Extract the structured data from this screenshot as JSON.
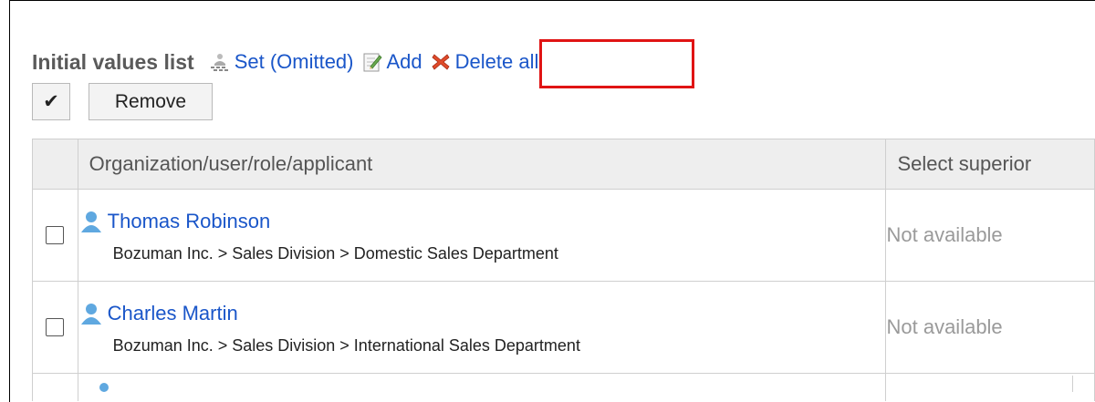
{
  "header": {
    "title": "Initial values list",
    "set_label": "Set (Omitted)",
    "add_label": "Add",
    "delete_all_label": "Delete all"
  },
  "toolbar": {
    "check_label": "✔",
    "remove_label": "Remove"
  },
  "table": {
    "columns": [
      "Organization/user/role/applicant",
      "Select superior"
    ],
    "rows": [
      {
        "name": "Thomas Robinson",
        "path": "Bozuman Inc. > Sales Division > Domestic Sales Department",
        "superior": "Not available"
      },
      {
        "name": "Charles Martin",
        "path": "Bozuman Inc. > Sales Division > International Sales Department",
        "superior": "Not available"
      }
    ]
  },
  "icons": {
    "set": "users-group-icon",
    "add": "edit-note-icon",
    "delete_all": "red-x-icon",
    "user": "user-icon"
  },
  "colors": {
    "link": "#1a56c9",
    "highlight": "#e01414",
    "header_bg": "#eeeeee",
    "muted": "#9a9a9a"
  }
}
